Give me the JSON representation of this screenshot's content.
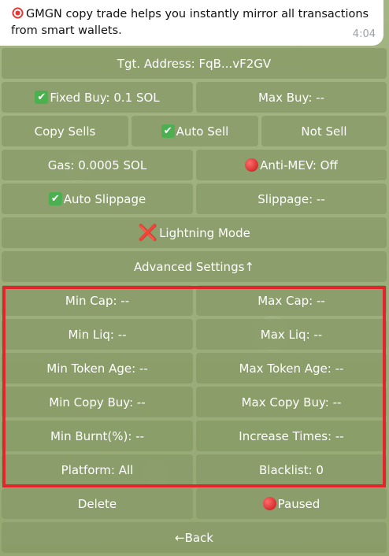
{
  "message": {
    "text": "GMGN copy trade helps you instantly mirror all transactions from smart wallets.",
    "time": "4:04",
    "icon": "target-icon"
  },
  "buttons": {
    "target_address": "Tgt. Address: FqB...vF2GV",
    "fixed_buy": "Fixed Buy: 0.1 SOL",
    "max_buy": "Max Buy: --",
    "copy_sells": "Copy Sells",
    "auto_sell": "Auto Sell",
    "not_sell": "Not Sell",
    "gas": "Gas: 0.0005 SOL",
    "anti_mev": "Anti-MEV: Off",
    "auto_slippage": "Auto Slippage",
    "slippage": "Slippage: --",
    "lightning_mode": "Lightning Mode",
    "advanced_settings": "Advanced Settings↑",
    "min_cap": "Min Cap: --",
    "max_cap": "Max Cap: --",
    "min_liq": "Min Liq: --",
    "max_liq": "Max Liq: --",
    "min_token_age": "Min Token Age: --",
    "max_token_age": "Max Token Age: --",
    "min_copy_buy": "Min Copy Buy: --",
    "max_copy_buy": "Max Copy Buy: --",
    "min_burnt": "Min Burnt(%): --",
    "increase_times": "Increase Times: --",
    "platform": "Platform: All",
    "blacklist": "Blacklist: 0",
    "delete": "Delete",
    "paused": "Paused",
    "back": "←Back"
  },
  "icons": {
    "check": "✔",
    "cross": "❌"
  },
  "colors": {
    "button_bg": "#879a66",
    "highlight": "#e0262b",
    "check_green": "#4caf50",
    "status_red": "#d32f2f"
  }
}
